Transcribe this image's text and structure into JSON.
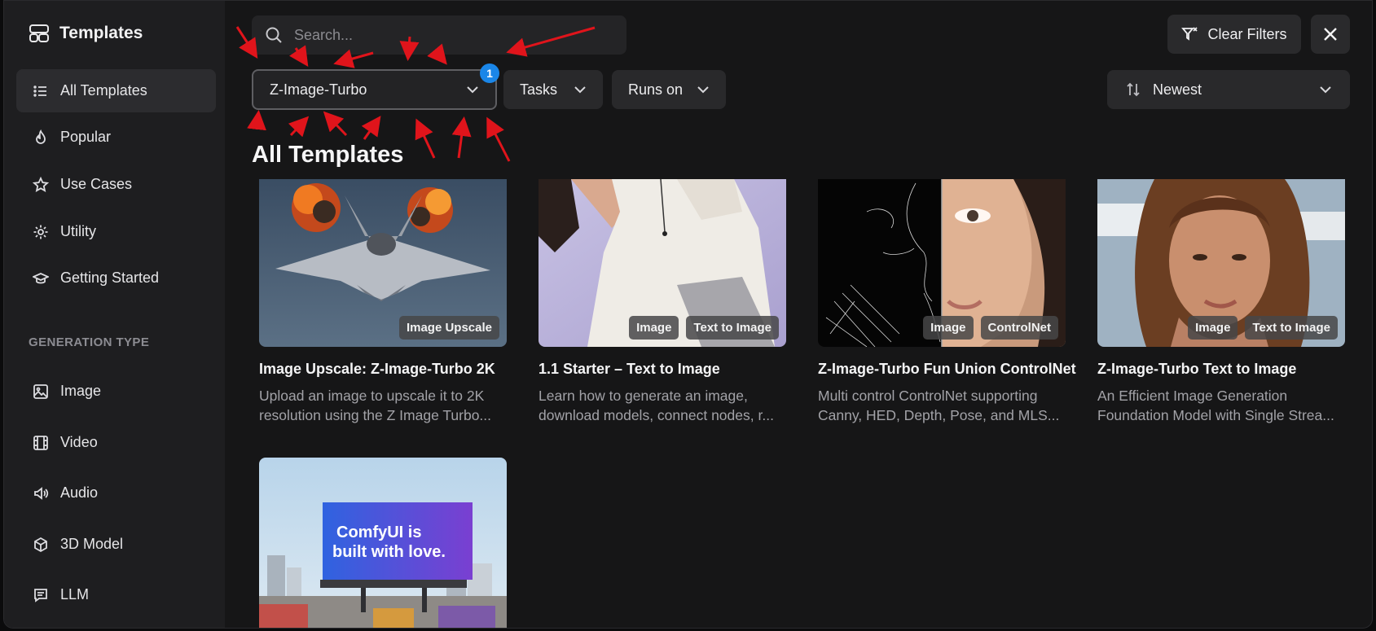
{
  "sidebar": {
    "title": "Templates",
    "items": [
      {
        "label": "All Templates",
        "icon": "list-icon"
      },
      {
        "label": "Popular",
        "icon": "flame-icon"
      },
      {
        "label": "Use Cases",
        "icon": "star-icon"
      },
      {
        "label": "Utility",
        "icon": "gear-icon"
      },
      {
        "label": "Getting Started",
        "icon": "graduation-cap-icon"
      }
    ],
    "section_label": "GENERATION TYPE",
    "generation_items": [
      {
        "label": "Image",
        "icon": "image-icon"
      },
      {
        "label": "Video",
        "icon": "film-icon"
      },
      {
        "label": "Audio",
        "icon": "speaker-icon"
      },
      {
        "label": "3D Model",
        "icon": "cube-icon"
      },
      {
        "label": "LLM",
        "icon": "chat-icon"
      }
    ]
  },
  "search": {
    "placeholder": "Search..."
  },
  "toolbar": {
    "clear_filters": "Clear Filters",
    "model_filter": "Z-Image-Turbo",
    "model_filter_count": "1",
    "tasks": "Tasks",
    "runs_on": "Runs on",
    "sort": "Newest"
  },
  "main": {
    "heading": "All Templates",
    "cards": [
      {
        "title": "Image Upscale: Z-Image-Turbo 2K",
        "desc1": "Upload an image to upscale it to 2K",
        "desc2": "resolution using the Z Image Turbo...",
        "tags": [
          "Image Upscale"
        ]
      },
      {
        "title": "1.1 Starter – Text to Image",
        "desc1": "Learn how to generate an image,",
        "desc2": "download models, connect nodes, r...",
        "tags": [
          "Image",
          "Text to Image"
        ]
      },
      {
        "title": "Z-Image-Turbo Fun Union ControlNet",
        "desc1": "Multi control ControlNet supporting",
        "desc2": "Canny, HED, Depth, Pose, and MLS...",
        "tags": [
          "Image",
          "ControlNet"
        ]
      },
      {
        "title": "Z-Image-Turbo Text to Image",
        "desc1": "An Efficient Image Generation",
        "desc2": "Foundation Model with Single Strea...",
        "tags": [
          "Image",
          "Text to Image"
        ]
      }
    ],
    "billboard": {
      "line1": "ComfyUI is",
      "line2": "built with love."
    }
  },
  "colors": {
    "accent_badge": "#1a86e8",
    "annotation_arrow": "#e0141b",
    "sidebar_bg": "#1e1e20",
    "main_bg": "#161617"
  }
}
